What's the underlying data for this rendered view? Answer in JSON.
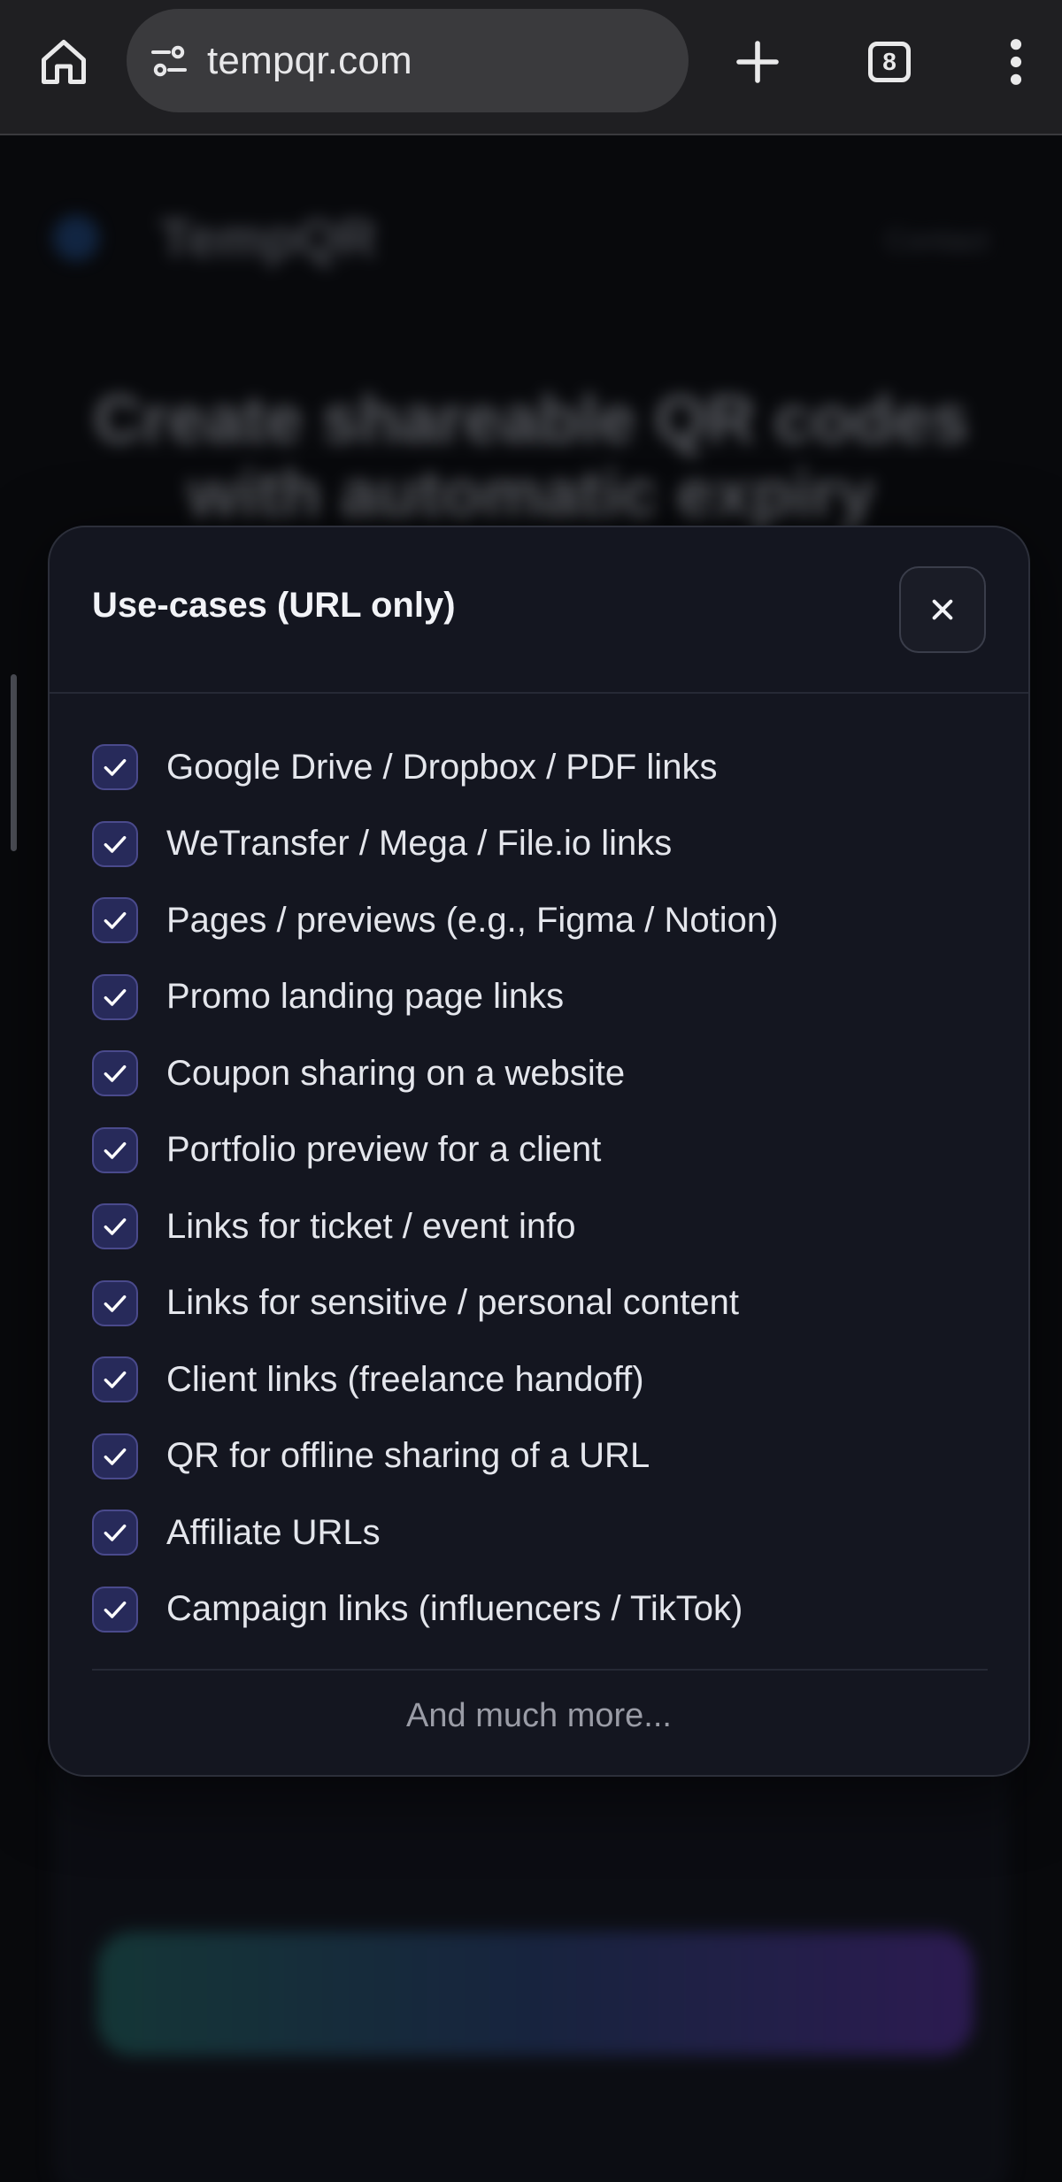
{
  "browser": {
    "url": "tempqr.com",
    "tab_count": "8",
    "icons": [
      "home-icon",
      "site-settings-icon",
      "plus-icon",
      "tab-switcher-icon",
      "more-vert-icon"
    ]
  },
  "background_page": {
    "brand": "TempQR",
    "header_link": "Contact",
    "hero_title": "Create shareable QR codes with automatic expiry"
  },
  "modal": {
    "title": "Use-cases (URL only)",
    "close_icon": "close-icon",
    "items": [
      "Google Drive / Dropbox / PDF links",
      "WeTransfer / Mega / File.io links",
      "Pages / previews (e.g., Figma / Notion)",
      "Promo landing page links",
      "Coupon sharing on a website",
      "Portfolio preview for a client",
      "Links for ticket / event info",
      "Links for sensitive / personal content",
      "Client links (freelance handoff)",
      "QR for offline sharing of a URL",
      "Affiliate URLs",
      "Campaign links (influencers / TikTok)"
    ],
    "more": "And much more..."
  },
  "colors": {
    "modal_bg": "#141620",
    "checkbox_bg": "#272a5a",
    "checkbox_border": "#4a4a8c",
    "chrome_bg": "#1f1f22",
    "omnibox_bg": "#3a3a3d"
  }
}
